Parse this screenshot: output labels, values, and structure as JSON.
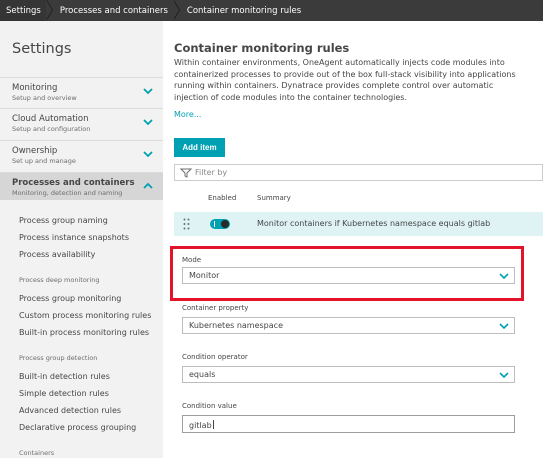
{
  "breadcrumb": {
    "items": [
      "Settings",
      "Processes and containers",
      "Container monitoring rules"
    ]
  },
  "sidebar": {
    "title": "Settings",
    "groups": [
      {
        "label": "Monitoring",
        "sub": "Setup and overview"
      },
      {
        "label": "Cloud Automation",
        "sub": "Setup and configuration"
      },
      {
        "label": "Ownership",
        "sub": "Set up and manage"
      },
      {
        "label": "Processes and containers",
        "sub": "Monitoring, detection and naming"
      }
    ],
    "items": [
      "Process group naming",
      "Process instance snapshots",
      "Process availability",
      "Process group monitoring",
      "Custom process monitoring rules",
      "Built-in process monitoring rules",
      "Built-in detection rules",
      "Simple detection rules",
      "Advanced detection rules",
      "Declarative process grouping"
    ],
    "sections": [
      "Process deep monitoring",
      "Process group detection",
      "Containers"
    ]
  },
  "main": {
    "title": "Container monitoring rules",
    "description": "Within container environments, OneAgent automatically injects code modules into containerized processes to provide out of the box full-stack visibility into applications running within containers. Dynatrace provides complete control over automatic injection of code modules into the container technologies.",
    "more_link": "More...",
    "add_button": "Add item",
    "filter_placeholder": "Filter by",
    "columns": {
      "enabled": "Enabled",
      "summary": "Summary"
    },
    "rule": {
      "summary": "Monitor containers if Kubernetes namespace equals gitlab",
      "enabled": true
    },
    "form": {
      "mode_label": "Mode",
      "mode_value": "Monitor",
      "property_label": "Container property",
      "property_value": "Kubernetes namespace",
      "operator_label": "Condition operator",
      "operator_value": "equals",
      "value_label": "Condition value",
      "value_value": "gitlab"
    }
  },
  "colors": {
    "accent": "#00a1b2",
    "highlight_box": "#e4122a",
    "breadcrumb_bg": "#3b3b3b",
    "sidebar_bg": "#f2f2f2",
    "row_selected": "#dff3f5"
  }
}
